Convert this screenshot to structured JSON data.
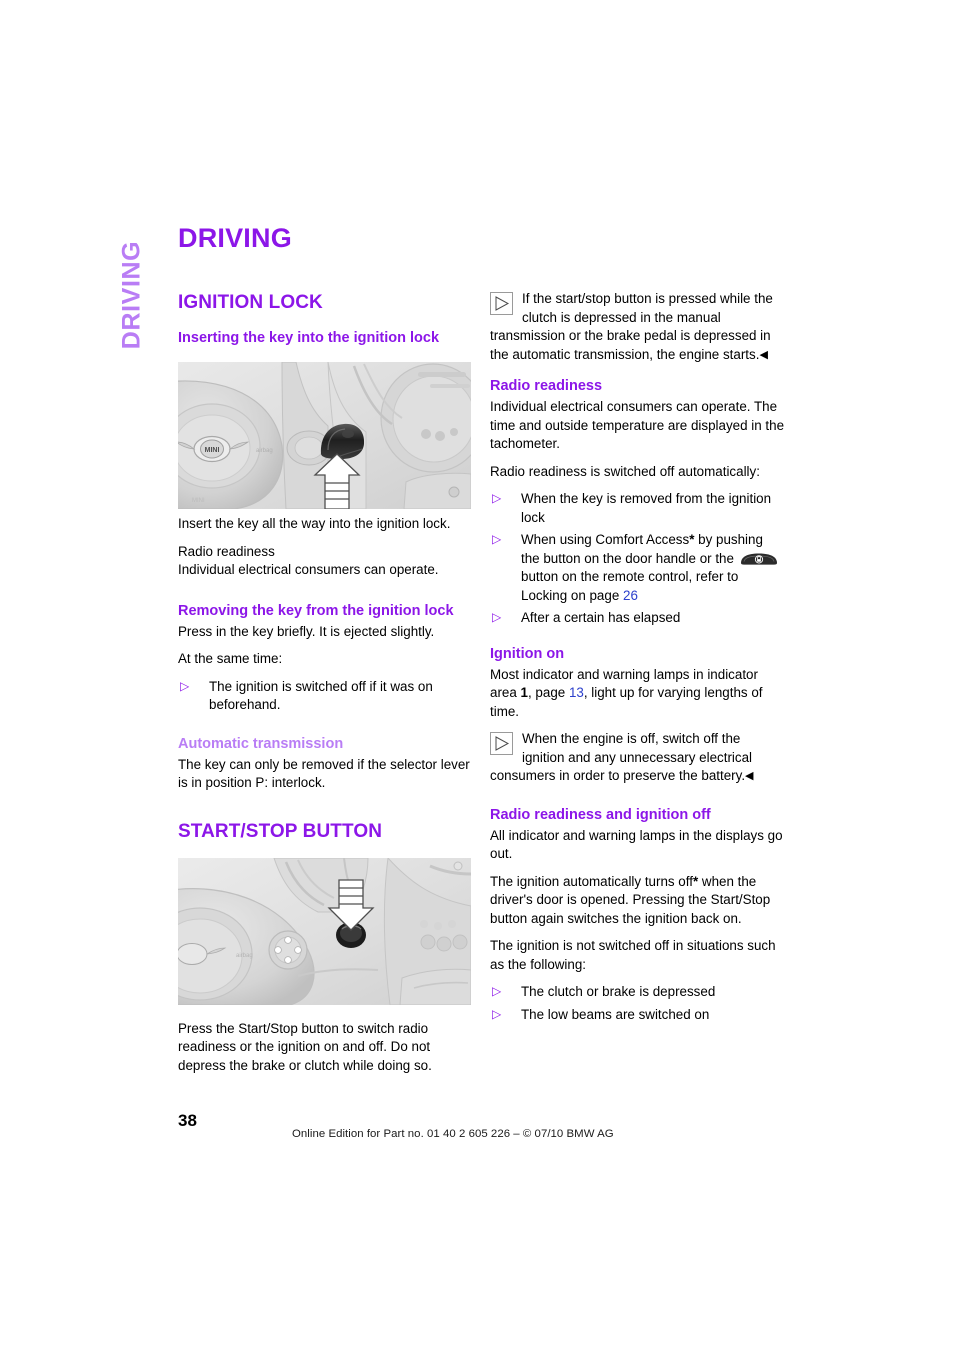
{
  "chapter_tab": "DRIVING",
  "page_title": "DRIVING",
  "colors": {
    "heading_purple": "#8c16e8",
    "light_purple": "#b97df5",
    "link_blue": "#2b3fcc"
  },
  "left_column": {
    "section_title": "IGNITION LOCK",
    "subsection_1": {
      "heading": "Inserting the key into the ignition lock",
      "figure_caption_alt": "MINI dashboard with ignition lock and key, arrow pointing up",
      "paragraphs": [
        "Insert the key all the way into the ignition lock."
      ],
      "block_lines": [
        "Radio readiness",
        "Individual electrical consumers can operate."
      ]
    },
    "subsection_2": {
      "heading": "Removing the key from the ignition lock",
      "paragraph_1": "Press in the key briefly. It is ejected slightly.",
      "paragraph_2": "At the same time:",
      "bullets": [
        "The ignition is switched off if it was on beforehand."
      ]
    },
    "subsection_3": {
      "heading": "Automatic transmission",
      "paragraph": "The key can only be removed if the selector lever is in position P: interlock."
    },
    "section_title_2": "START/STOP BUTTON",
    "figure_2_caption_alt": "Steering wheel with Start/Stop button, arrow pointing down",
    "paragraph_after_figure_2": "Press the Start/Stop button to switch radio readiness or the ignition on and off. Do not depress the brake or clutch while doing so."
  },
  "right_column": {
    "note_1": {
      "icon": "note-triangle-icon",
      "text": "If the start/stop button is pressed while the clutch is depressed in the manual transmission or the brake pedal is depressed in the automatic transmission, the engine starts.",
      "end_mark": "◀"
    },
    "radio_readiness": {
      "heading": "Radio readiness",
      "paragraph_1": "Individual electrical consumers can operate. The time and outside temperature are displayed in the tachometer.",
      "paragraph_2": "Radio readiness is switched off automatically:",
      "bullet_1": "When the key is removed from the ignition lock",
      "bullet_2_part_1": "When using Comfort Access",
      "bullet_2_star": "*",
      "bullet_2_part_2": " by pushing the button on the door handle or the",
      "bullet_2_part_3": "button on the remote control, refer to Locking on page",
      "bullet_2_page_link": "26",
      "bullet_3": "After a certain has elapsed"
    },
    "ignition_on": {
      "heading": "Ignition on",
      "paragraph_part_1": "Most indicator and warning lamps in indicator area ",
      "paragraph_bold": "1",
      "paragraph_part_2": ", page ",
      "paragraph_link": "13",
      "paragraph_part_3": ", light up for varying lengths of time.",
      "note": {
        "icon": "note-triangle-icon",
        "text": "When the engine is off, switch off the ignition and any unnecessary electrical consumers in order to preserve the battery.",
        "end_mark": "◀"
      }
    },
    "radio_ignition_off": {
      "heading": "Radio readiness and ignition off",
      "paragraph_1": "All indicator and warning lamps in the displays go out.",
      "paragraph_2_part_1": "The ignition automatically turns off",
      "paragraph_2_star": "*",
      "paragraph_2_part_2": " when the driver's door is opened. Pressing the Start/Stop button again switches the ignition back on.",
      "paragraph_3": "The ignition is not switched off in situations such as the following:",
      "bullets": [
        "The clutch or brake is depressed",
        "The low beams are switched on"
      ]
    }
  },
  "footer": {
    "page_number": "38",
    "edition_note": "Online Edition for Part no. 01 40 2 605 226 – © 07/10  BMW AG"
  }
}
